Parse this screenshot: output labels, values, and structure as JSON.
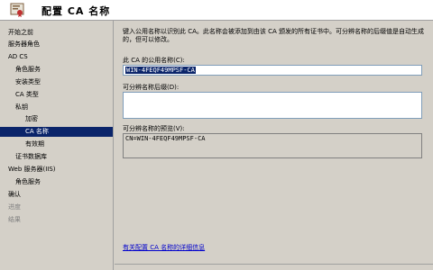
{
  "window": {
    "title": "配置 CA 名称",
    "icon": "certificate-wizard-icon"
  },
  "sidebar": {
    "items": [
      {
        "label": "开始之前",
        "indent": 0,
        "state": "normal"
      },
      {
        "label": "服务器角色",
        "indent": 0,
        "state": "normal"
      },
      {
        "label": "AD CS",
        "indent": 0,
        "state": "normal"
      },
      {
        "label": "角色服务",
        "indent": 1,
        "state": "normal"
      },
      {
        "label": "安装类型",
        "indent": 1,
        "state": "normal"
      },
      {
        "label": "CA 类型",
        "indent": 1,
        "state": "normal"
      },
      {
        "label": "私钥",
        "indent": 1,
        "state": "normal"
      },
      {
        "label": "加密",
        "indent": 2,
        "state": "normal"
      },
      {
        "label": "CA 名称",
        "indent": 2,
        "state": "selected"
      },
      {
        "label": "有效期",
        "indent": 2,
        "state": "normal"
      },
      {
        "label": "证书数据库",
        "indent": 1,
        "state": "normal"
      },
      {
        "label": "Web 服务器(IIS)",
        "indent": 0,
        "state": "normal"
      },
      {
        "label": "角色服务",
        "indent": 1,
        "state": "normal"
      },
      {
        "label": "确认",
        "indent": 0,
        "state": "normal"
      },
      {
        "label": "进度",
        "indent": 0,
        "state": "disabled"
      },
      {
        "label": "结果",
        "indent": 0,
        "state": "disabled"
      }
    ]
  },
  "main": {
    "intro": "键入公用名称以识别此 CA。此名称会被添加到由该 CA 颁发的所有证书中。可分辨名称的后缀值是自动生成的，但可以修改。",
    "common_name_label": "此 CA 的公用名称(C):",
    "common_name_value": "WIN-4FEQF49MPSF-CA",
    "dn_suffix_label": "可分辨名称后缀(D):",
    "dn_suffix_value": "",
    "preview_label": "可分辨名称的预览(V):",
    "preview_value": "CN=WIN-4FEQF49MPSF-CA",
    "help_link": "有关配置 CA 名称的详细信息"
  }
}
